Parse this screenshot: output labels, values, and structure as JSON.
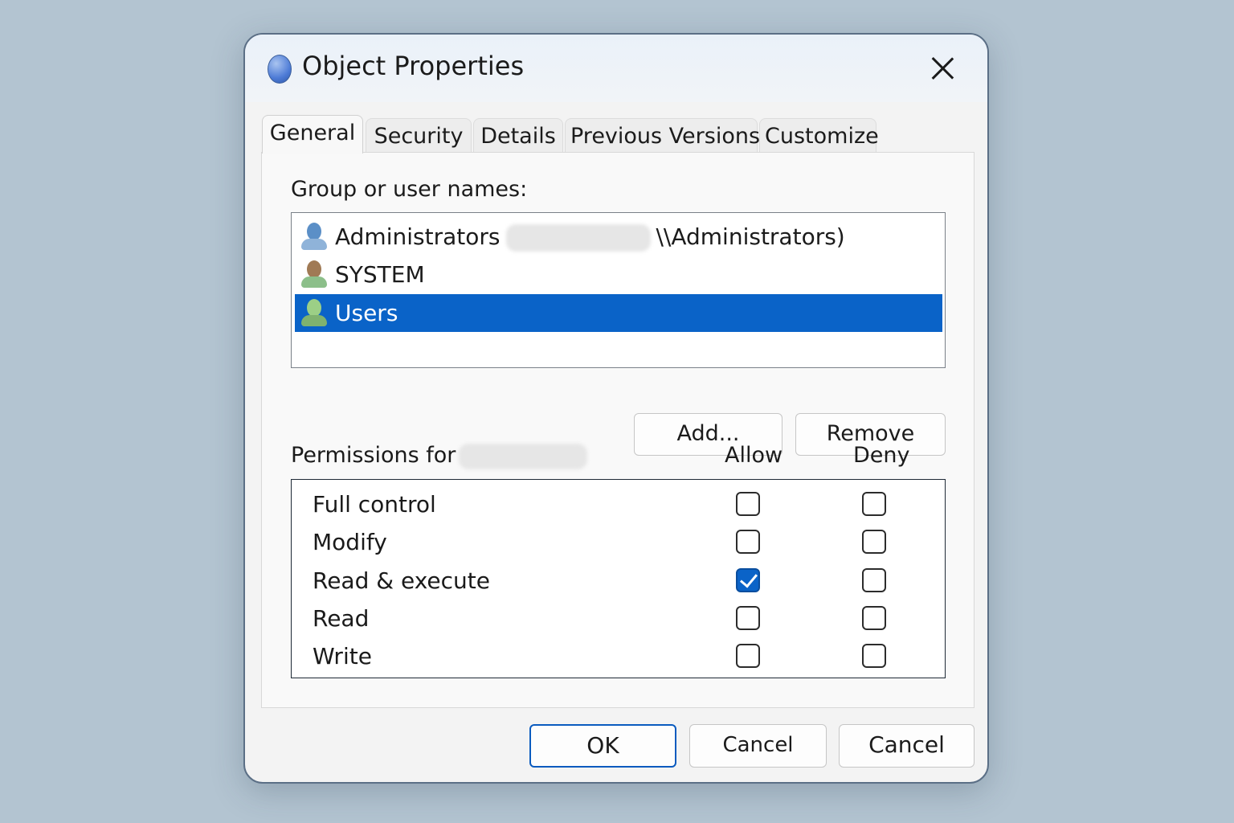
{
  "window": {
    "title": "Object Properties",
    "icon": "app-orb-icon",
    "close_icon": "close-icon"
  },
  "tabs": [
    {
      "label": "General",
      "active": true
    },
    {
      "label": "Security",
      "active": false
    },
    {
      "label": "Details",
      "active": false
    },
    {
      "label": "Previous Versions",
      "active": false
    },
    {
      "label": "Customize",
      "active": false
    }
  ],
  "security": {
    "group_label": "Group or user names:",
    "users": [
      {
        "name": "Administrators",
        "suffix": "\\\\Administrators)",
        "redacted": true,
        "icon": "user-group-icon",
        "icon_color": "#5b8fc7"
      },
      {
        "name": "SYSTEM",
        "icon": "system-user-icon",
        "icon_color": "#a07a55"
      },
      {
        "name": "Users",
        "icon": "users-icon",
        "icon_color": "#9ccf86",
        "selected": true
      }
    ],
    "add_button": "Add...",
    "remove_button": "Remove",
    "permissions_label": "Permissions for",
    "allow_header": "Allow",
    "deny_header": "Deny",
    "permissions": [
      {
        "name": "Full control",
        "allow": false,
        "deny": false
      },
      {
        "name": "Modify",
        "allow": false,
        "deny": false
      },
      {
        "name": "Read & execute",
        "allow": true,
        "deny": false
      },
      {
        "name": "Read",
        "allow": false,
        "deny": false
      },
      {
        "name": "Write",
        "allow": false,
        "deny": false
      }
    ]
  },
  "footer": {
    "ok": "OK",
    "cancel_1": "Cancel",
    "cancel_2": "Cancel"
  },
  "colors": {
    "selection": "#0a63c8",
    "background": "#b3c4d1"
  }
}
